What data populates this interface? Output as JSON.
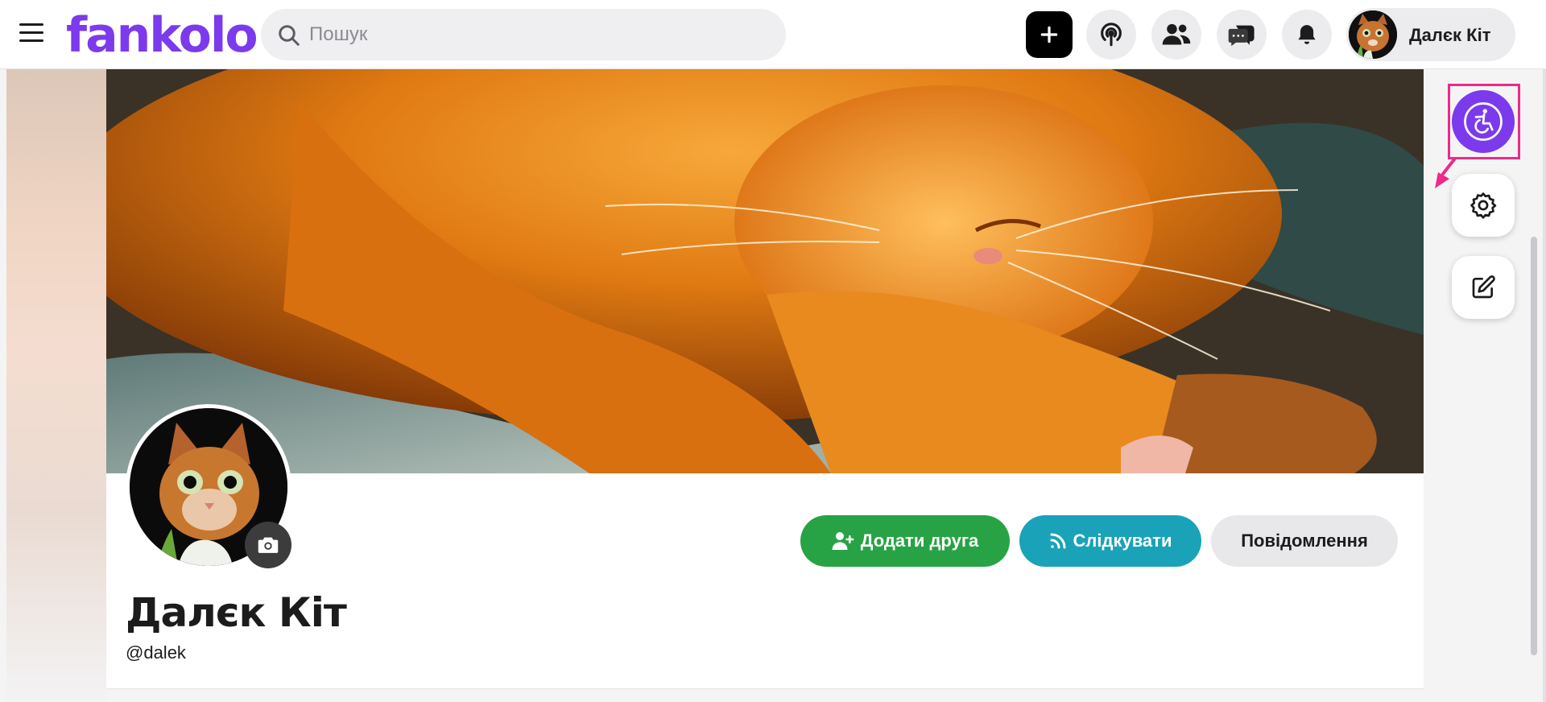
{
  "header": {
    "logo_text": "fankolo",
    "search": {
      "placeholder": "Пошук",
      "value": ""
    },
    "profile_name": "Далєк Кіт",
    "buttons": {
      "create": "plus-icon",
      "broadcast": "podcast-icon",
      "friends": "users-icon",
      "messages": "chat-icon",
      "notifications": "bell-icon"
    }
  },
  "profile": {
    "display_name": "Далєк Кіт",
    "handle": "@dalek",
    "actions": {
      "add_friend": "Додати друга",
      "follow": "Слідкувати",
      "message": "Повідомлення"
    }
  },
  "side_buttons": {
    "accessibility": "accessibility-icon",
    "settings": "gear-icon",
    "edit": "edit-icon"
  },
  "colors": {
    "brand": "#7c3aed",
    "add_friend": "#27a345",
    "follow": "#1aa2b8",
    "highlight": "#ec2a8a"
  }
}
